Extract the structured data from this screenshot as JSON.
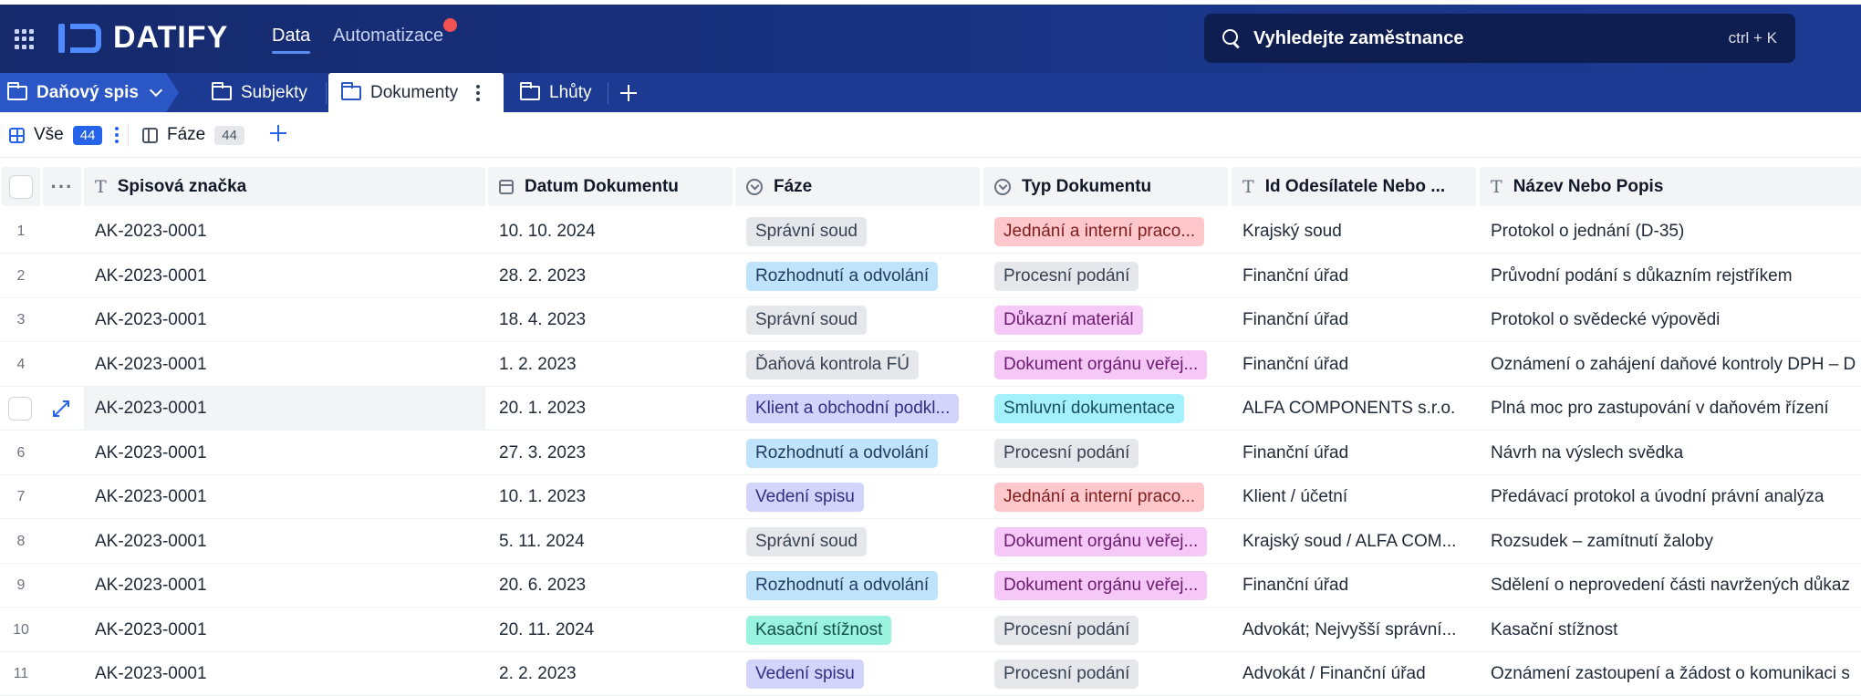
{
  "app": {
    "logo_text": "DATIFY",
    "nav_tabs": [
      "Data",
      "Automatizace"
    ],
    "search": {
      "placeholder": "Vyhledejte zaměstnance",
      "shortcut": "ctrl + K"
    }
  },
  "breadcrumb": {
    "label": "Daňový spis"
  },
  "module_tabs": [
    "Subjekty",
    "Dokumenty",
    "Lhůty"
  ],
  "views": [
    {
      "label": "Vše",
      "count": "44"
    },
    {
      "label": "Fáze",
      "count": "44"
    }
  ],
  "table": {
    "columns": [
      "Spisová značka",
      "Datum Dokumentu",
      "Fáze",
      "Typ Dokumentu",
      "Id Odesílatele Nebo ...",
      "Název Nebo Popis"
    ],
    "rows": [
      {
        "num": "1",
        "spis": "AK-2023-0001",
        "datum": "10. 10. 2024",
        "faze": "Správní soud",
        "typ": "Jednání a interní praco...",
        "odesilatel": "Krajský soud",
        "nazev": "Protokol o jednání (D-35)"
      },
      {
        "num": "2",
        "spis": "AK-2023-0001",
        "datum": "28. 2. 2023",
        "faze": "Rozhodnutí a odvolání",
        "typ": "Procesní podání",
        "odesilatel": "Finanční úřad",
        "nazev": "Průvodní podání s důkazním rejstříkem"
      },
      {
        "num": "3",
        "spis": "AK-2023-0001",
        "datum": "18. 4. 2023",
        "faze": "Správní soud",
        "typ": "Důkazní materiál",
        "odesilatel": "Finanční úřad",
        "nazev": "Protokol o svědecké výpovědi"
      },
      {
        "num": "4",
        "spis": "AK-2023-0001",
        "datum": "1. 2. 2023",
        "faze": "Ďaňová kontrola FÚ",
        "typ": "Dokument orgánu veřej...",
        "odesilatel": "Finanční úřad",
        "nazev": "Oznámení o zahájení daňové kontroly DPH – D"
      },
      {
        "num": "",
        "spis": "AK-2023-0001",
        "datum": "20. 1. 2023",
        "faze": "Klient a obchodní podkl...",
        "typ": "Smluvní dokumentace",
        "odesilatel": "ALFA COMPONENTS s.r.o.",
        "nazev": "Plná moc pro zastupování v daňovém řízení"
      },
      {
        "num": "6",
        "spis": "AK-2023-0001",
        "datum": "27. 3. 2023",
        "faze": "Rozhodnutí a odvolání",
        "typ": "Procesní podání",
        "odesilatel": "Finanční úřad",
        "nazev": "Návrh na výslech svědka"
      },
      {
        "num": "7",
        "spis": "AK-2023-0001",
        "datum": "10. 1. 2023",
        "faze": "Vedení spisu",
        "typ": "Jednání a interní praco...",
        "odesilatel": "Klient / účetní",
        "nazev": "Předávací protokol a úvodní právní analýza"
      },
      {
        "num": "8",
        "spis": "AK-2023-0001",
        "datum": "5. 11. 2024",
        "faze": "Správní soud",
        "typ": "Dokument orgánu veřej...",
        "odesilatel": "Krajský soud / ALFA COM...",
        "nazev": "Rozsudek – zamítnutí žaloby"
      },
      {
        "num": "9",
        "spis": "AK-2023-0001",
        "datum": "20. 6. 2023",
        "faze": "Rozhodnutí a odvolání",
        "typ": "Dokument orgánu veřej...",
        "odesilatel": "Finanční úřad",
        "nazev": "Sdělení o neprovedení části navržených důkaz"
      },
      {
        "num": "10",
        "spis": "AK-2023-0001",
        "datum": "20. 11. 2024",
        "faze": "Kasační stížnost",
        "typ": "Procesní podání",
        "odesilatel": "Advokát; Nejvyšší správní...",
        "nazev": "Kasační stížnost"
      },
      {
        "num": "11",
        "spis": "AK-2023-0001",
        "datum": "2. 2. 2023",
        "faze": "Vedení spisu",
        "typ": "Procesní podání",
        "odesilatel": "Advokát / Finanční úřad",
        "nazev": "Oznámení zastoupení a žádost o komunikaci s"
      }
    ]
  }
}
